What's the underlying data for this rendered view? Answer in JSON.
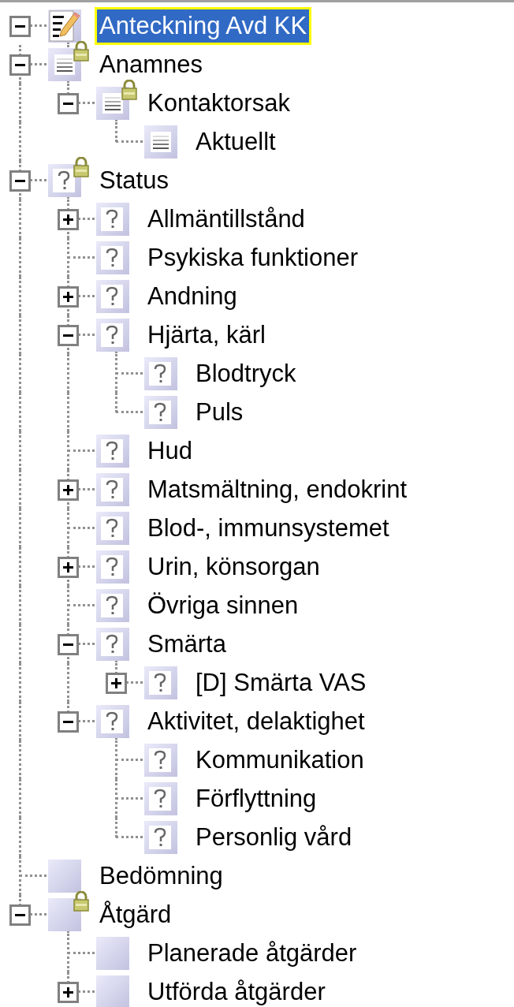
{
  "tree": [
    {
      "label": "Anteckning Avd KK",
      "kind": "note",
      "locked": false,
      "selected": true,
      "expanded": true,
      "children": [
        {
          "label": "Anamnes",
          "kind": "document",
          "locked": true,
          "selected": false,
          "expanded": true,
          "children": [
            {
              "label": "Kontaktorsak",
              "kind": "document",
              "locked": true,
              "selected": false,
              "expanded": true,
              "children": [
                {
                  "label": "Aktuellt",
                  "kind": "document",
                  "locked": false,
                  "selected": false
                }
              ]
            }
          ]
        },
        {
          "label": "Status",
          "kind": "question",
          "locked": true,
          "selected": false,
          "expanded": true,
          "children": [
            {
              "label": "Allmäntillstånd",
              "kind": "question",
              "locked": false,
              "selected": false,
              "expanded": false
            },
            {
              "label": "Psykiska funktioner",
              "kind": "question",
              "locked": false,
              "selected": false
            },
            {
              "label": "Andning",
              "kind": "question",
              "locked": false,
              "selected": false,
              "expanded": false
            },
            {
              "label": "Hjärta, kärl",
              "kind": "question",
              "locked": false,
              "selected": false,
              "expanded": true,
              "children": [
                {
                  "label": "Blodtryck",
                  "kind": "question",
                  "locked": false,
                  "selected": false
                },
                {
                  "label": "Puls",
                  "kind": "question",
                  "locked": false,
                  "selected": false
                }
              ]
            },
            {
              "label": "Hud",
              "kind": "question",
              "locked": false,
              "selected": false
            },
            {
              "label": "Matsmältning, endokrint",
              "kind": "question",
              "locked": false,
              "selected": false,
              "expanded": false
            },
            {
              "label": "Blod-, immunsystemet",
              "kind": "question",
              "locked": false,
              "selected": false
            },
            {
              "label": "Urin, könsorgan",
              "kind": "question",
              "locked": false,
              "selected": false,
              "expanded": false
            },
            {
              "label": "Övriga sinnen",
              "kind": "question",
              "locked": false,
              "selected": false
            },
            {
              "label": "Smärta",
              "kind": "question",
              "locked": false,
              "selected": false,
              "expanded": true,
              "children": [
                {
                  "label": "[D] Smärta VAS",
                  "kind": "question",
                  "locked": false,
                  "selected": false,
                  "expanded": false
                }
              ]
            },
            {
              "label": "Aktivitet, delaktighet",
              "kind": "question",
              "locked": false,
              "selected": false,
              "expanded": true,
              "children": [
                {
                  "label": "Kommunikation",
                  "kind": "question",
                  "locked": false,
                  "selected": false
                },
                {
                  "label": "Förflyttning",
                  "kind": "question",
                  "locked": false,
                  "selected": false
                },
                {
                  "label": "Personlig vård",
                  "kind": "question",
                  "locked": false,
                  "selected": false
                }
              ]
            }
          ]
        },
        {
          "label": "Bedömning",
          "kind": "blank",
          "locked": false,
          "selected": false
        },
        {
          "label": "Åtgärd",
          "kind": "blank",
          "locked": true,
          "selected": false,
          "expanded": true,
          "children": [
            {
              "label": "Planerade åtgärder",
              "kind": "blank",
              "locked": false,
              "selected": false
            },
            {
              "label": "Utförda åtgärder",
              "kind": "blank",
              "locked": false,
              "selected": false,
              "expanded": false
            }
          ]
        }
      ]
    }
  ]
}
